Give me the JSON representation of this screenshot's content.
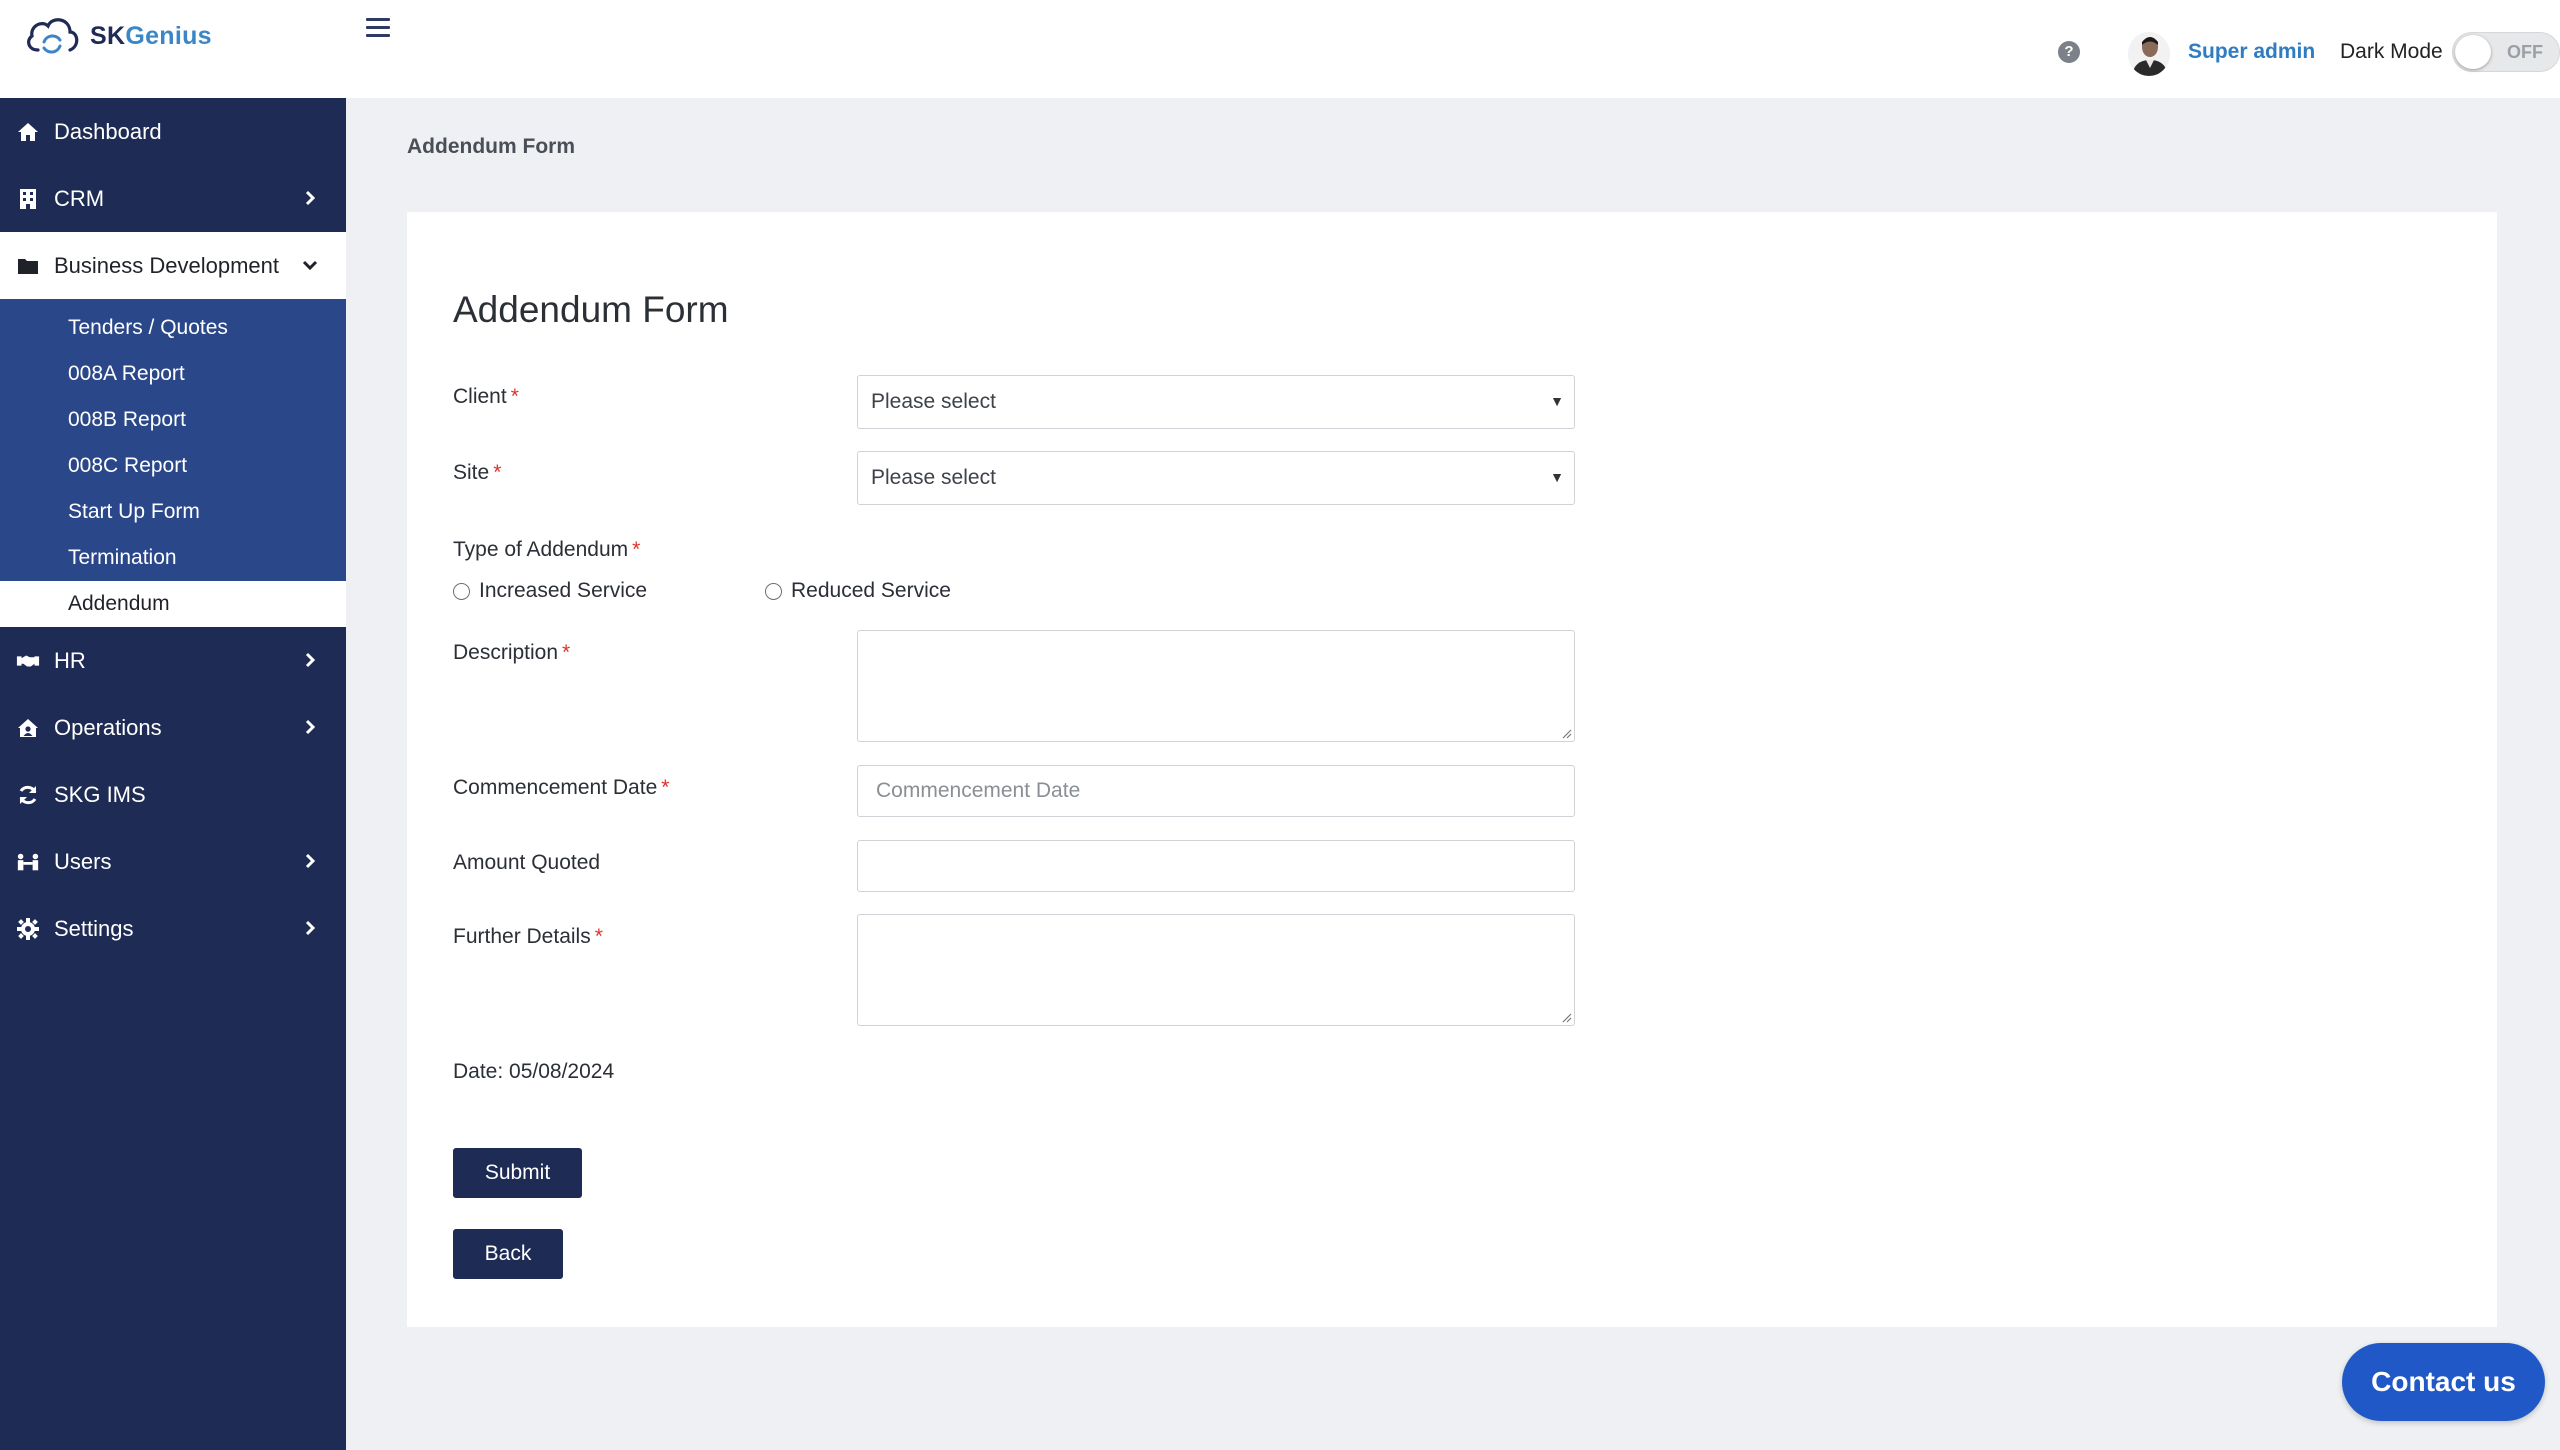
{
  "header": {
    "logo_text_1": "SK",
    "logo_text_2": "Genius",
    "user_name": "Super admin",
    "dark_mode_label": "Dark Mode",
    "dark_mode_state": "OFF"
  },
  "sidebar": {
    "items": [
      {
        "label": "Dashboard",
        "icon": "home-icon"
      },
      {
        "label": "CRM",
        "icon": "building-icon"
      },
      {
        "label": "Business Development",
        "icon": "folder-icon"
      },
      {
        "label": "HR",
        "icon": "handshake-icon"
      },
      {
        "label": "Operations",
        "icon": "house-user-icon"
      },
      {
        "label": "SKG IMS",
        "icon": "sync-icon"
      },
      {
        "label": "Users",
        "icon": "users-icon"
      },
      {
        "label": "Settings",
        "icon": "gear-icon"
      }
    ],
    "submenu": [
      "Tenders / Quotes",
      "008A Report",
      "008B Report",
      "008C Report",
      "Start Up Form",
      "Termination",
      "Addendum"
    ]
  },
  "breadcrumb": "Addendum Form",
  "form": {
    "title": "Addendum Form",
    "client_label": "Client",
    "client_value": "Please select",
    "site_label": "Site",
    "site_value": "Please select",
    "type_label": "Type of Addendum",
    "option_increased": "Increased Service",
    "option_reduced": "Reduced Service",
    "description_label": "Description",
    "commencement_label": "Commencement Date",
    "commencement_placeholder": "Commencement Date",
    "amount_label": "Amount Quoted",
    "further_label": "Further Details",
    "required_mark": "*",
    "date_line": "Date: 05/08/2024",
    "submit_label": "Submit",
    "back_label": "Back"
  },
  "contact_label": "Contact us",
  "colors": {
    "sidebar_bg": "#1e2b55",
    "submenu_bg": "#2a4789",
    "accent_blue": "#2f7cc2",
    "contact_bg": "#2158c8",
    "required": "#e0302b"
  }
}
